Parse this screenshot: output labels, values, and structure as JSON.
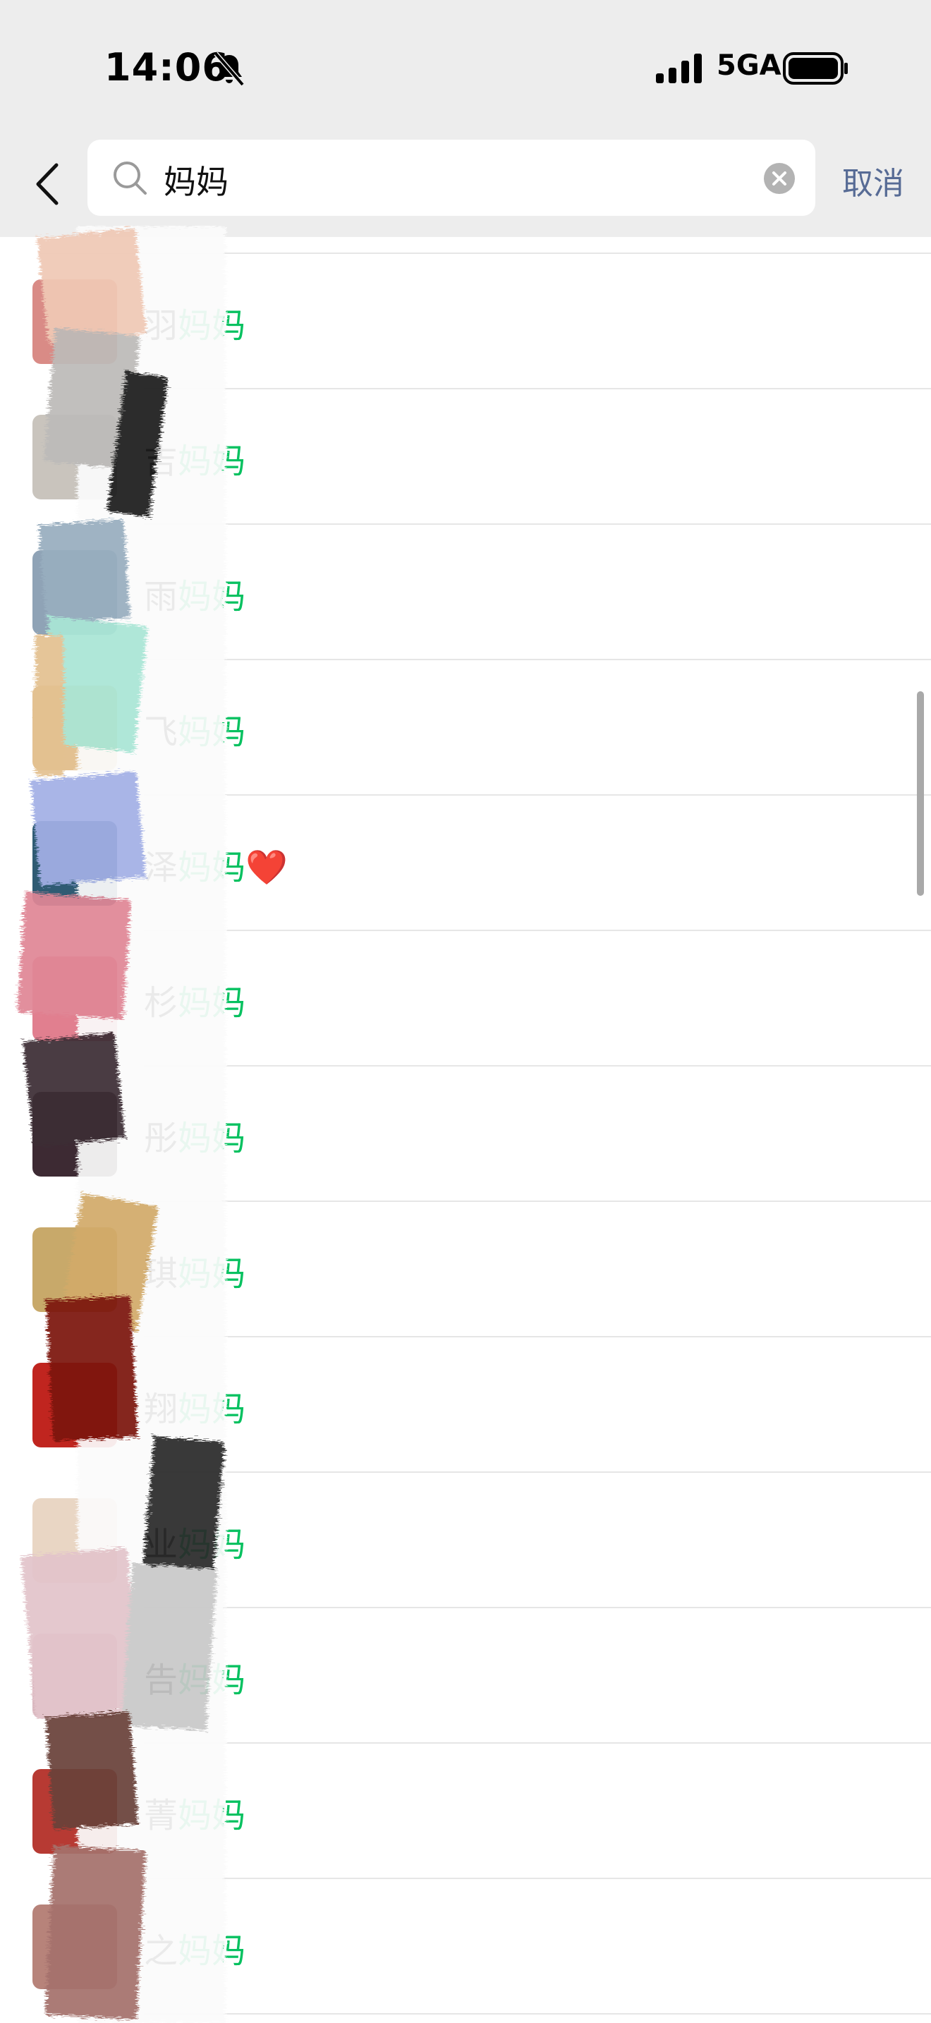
{
  "status_bar": {
    "time": "14:06",
    "network": "5GA",
    "icons": [
      "bell-slash-icon",
      "signal-bars-icon",
      "battery-icon"
    ]
  },
  "search": {
    "query": "妈妈",
    "cancel_label": "取消",
    "icons": [
      "back-chevron-icon",
      "search-icon",
      "clear-icon"
    ]
  },
  "colors": {
    "highlight": "#07c160",
    "cancel_link": "#576b95",
    "header_bg": "#ededed",
    "heart": "#e8231f"
  },
  "results": [
    {
      "prefix": "羽",
      "match": "妈妈",
      "suffix": "",
      "avatar_color": "#d98b86"
    },
    {
      "prefix": "吉",
      "match": "妈妈",
      "suffix": "",
      "avatar_color": "#c9c4bd"
    },
    {
      "prefix": "雨",
      "match": "妈妈",
      "suffix": "",
      "avatar_color": "#8fa3b6"
    },
    {
      "prefix": "飞",
      "match": "妈妈",
      "suffix": "",
      "avatar_color": "#e3c191"
    },
    {
      "prefix": "泽",
      "match": "妈妈",
      "suffix": "❤️",
      "avatar_color": "#2f5b73"
    },
    {
      "prefix": "杉",
      "match": "妈妈",
      "suffix": "",
      "avatar_color": "#e17f8f"
    },
    {
      "prefix": "彤",
      "match": "妈妈",
      "suffix": "",
      "avatar_color": "#3d2a33"
    },
    {
      "prefix": "琪",
      "match": "妈妈",
      "suffix": "",
      "avatar_color": "#c8a96a"
    },
    {
      "prefix": "翔",
      "match": "妈妈",
      "suffix": "",
      "avatar_color": "#c0251f"
    },
    {
      "prefix": "业",
      "match": "妈妈",
      "suffix": "",
      "avatar_color": "#e9d6c4"
    },
    {
      "prefix": "告",
      "match": "妈妈",
      "suffix": "",
      "avatar_color": "#d9b7bf"
    },
    {
      "prefix": "菁",
      "match": "妈妈",
      "suffix": "",
      "avatar_color": "#b73a33"
    },
    {
      "prefix": "之",
      "match": "妈妈",
      "suffix": "",
      "avatar_color": "#b7837a"
    }
  ]
}
